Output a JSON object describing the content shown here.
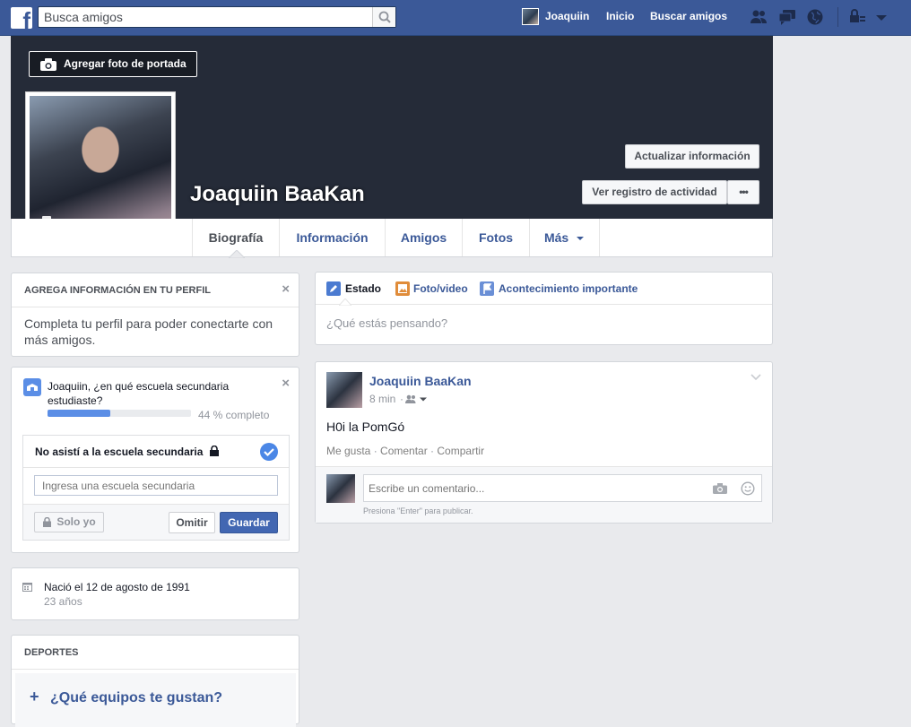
{
  "topbar": {
    "search_placeholder": "Busca amigos",
    "user_name": "Joaquiin",
    "home": "Inicio",
    "find_friends": "Buscar amigos"
  },
  "cover": {
    "add_cover_label": "Agregar foto de portada",
    "name": "Joaquiin BaaKan",
    "update_info": "Actualizar información",
    "activity_log": "Ver registro de actividad",
    "more_dots": "•••"
  },
  "tabs": [
    {
      "label": "Biografía"
    },
    {
      "label": "Información"
    },
    {
      "label": "Amigos"
    },
    {
      "label": "Fotos"
    },
    {
      "label": "Más"
    }
  ],
  "left": {
    "add_info_header": "AGREGA INFORMACIÓN EN TU PERFIL",
    "add_info_text": "Completa tu perfil para poder conectarte con más amigos.",
    "school_question": "Joaquiin, ¿en qué escuela secundaria estudiaste?",
    "progress_text": "44 % completo",
    "progress_value": 0.44,
    "no_school": "No asistí a la escuela secundaria",
    "school_placeholder": "Ingresa una escuela secundaria",
    "privacy": "Solo yo",
    "skip": "Omitir",
    "save": "Guardar",
    "born": "Nació el 12 de agosto de 1991",
    "age": "23 años",
    "sports_header": "DEPORTES",
    "teams_question": "¿Qué equipos te gustan?"
  },
  "composer": {
    "status": "Estado",
    "photo_video": "Foto/video",
    "life_event": "Acontecimiento importante",
    "placeholder": "¿Qué estás pensando?"
  },
  "post": {
    "author": "Joaquiin BaaKan",
    "time": "8 min",
    "separator": "·",
    "text": "H0i la PomGó",
    "like": "Me gusta",
    "comment": "Comentar",
    "share": "Compartir",
    "comment_placeholder": "Escribe un comentario...",
    "enter_hint": "Presiona \"Enter\" para publicar."
  },
  "colors": {
    "brand_blue": "#3b5998",
    "cover_dark": "#252b38",
    "progress_blue": "#5b8ee6",
    "save_button": "#4267b2"
  },
  "icons": [
    "facebook-logo-icon",
    "search-icon",
    "friend-requests-icon",
    "messages-icon",
    "notifications-globe-icon",
    "privacy-shortcuts-icon",
    "account-menu-chevron-icon",
    "camera-icon",
    "pencil-icon",
    "photo-icon",
    "flag-icon",
    "school-icon",
    "check-icon",
    "lock-icon",
    "calendar-icon",
    "plus-icon",
    "smiley-icon",
    "audience-friends-icon"
  ]
}
